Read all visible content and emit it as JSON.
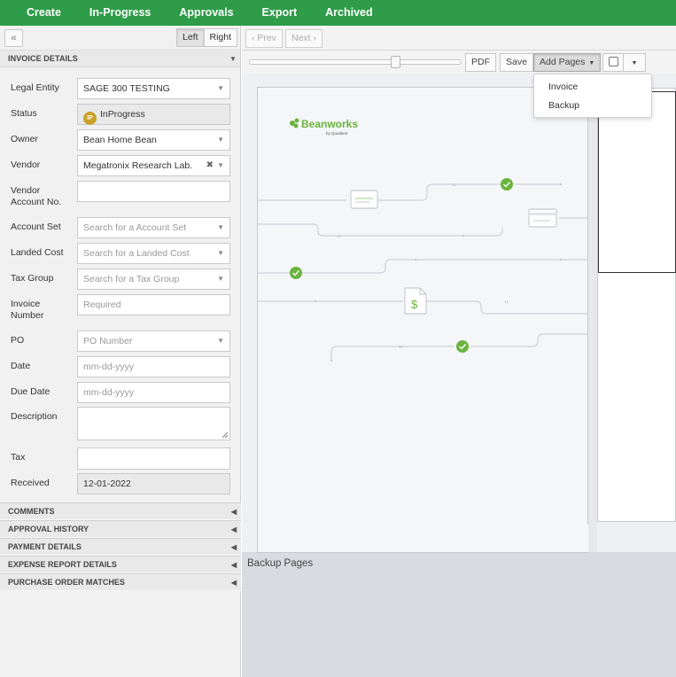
{
  "topnav": {
    "items": [
      "Create",
      "In-Progress",
      "Approvals",
      "Export",
      "Archived"
    ]
  },
  "left_toolbar": {
    "collapse_label": "«",
    "left_label": "Left",
    "right_label": "Right"
  },
  "invoice_details": {
    "header": "INVOICE DETAILS",
    "fields": {
      "legal_entity": {
        "label": "Legal Entity",
        "value": "SAGE 300 TESTING"
      },
      "status": {
        "label": "Status",
        "badge": "IP",
        "value": "InProgress"
      },
      "owner": {
        "label": "Owner",
        "value": "Bean Home Bean"
      },
      "vendor": {
        "label": "Vendor",
        "value": "Megatronix Research Lab."
      },
      "vendor_account": {
        "label": "Vendor Account No.",
        "value": ""
      },
      "account_set": {
        "label": "Account Set",
        "placeholder": "Search for a Account Set"
      },
      "landed_cost": {
        "label": "Landed Cost",
        "placeholder": "Search for a Landed Cost"
      },
      "tax_group": {
        "label": "Tax Group",
        "placeholder": "Search for a Tax Group"
      },
      "invoice_number": {
        "label": "Invoice Number",
        "placeholder": "Required"
      },
      "po": {
        "label": "PO",
        "placeholder": "PO Number"
      },
      "date": {
        "label": "Date",
        "placeholder": "mm-dd-yyyy"
      },
      "due_date": {
        "label": "Due Date",
        "placeholder": "mm-dd-yyyy"
      },
      "description": {
        "label": "Description",
        "value": ""
      },
      "tax": {
        "label": "Tax",
        "value": ""
      },
      "received": {
        "label": "Received",
        "value": "12-01-2022"
      }
    }
  },
  "accordion": [
    "COMMENTS",
    "APPROVAL HISTORY",
    "PAYMENT DETAILS",
    "EXPENSE REPORT DETAILS",
    "PURCHASE ORDER MATCHES"
  ],
  "viewer": {
    "prev_label": "Prev",
    "next_label": "Next",
    "pdf_label": "PDF",
    "save_label": "Save",
    "add_pages_label": "Add Pages",
    "zoom_level": 0.7,
    "dropdown_options": [
      "Invoice",
      "Backup"
    ],
    "logo_text": "Beanworks",
    "logo_sub": "by Quadient",
    "backup_label": "Backup Pages"
  },
  "colors": {
    "nav_green": "#2e9c48",
    "check_green": "#6ab33e",
    "badge_gold": "#c9a227"
  }
}
